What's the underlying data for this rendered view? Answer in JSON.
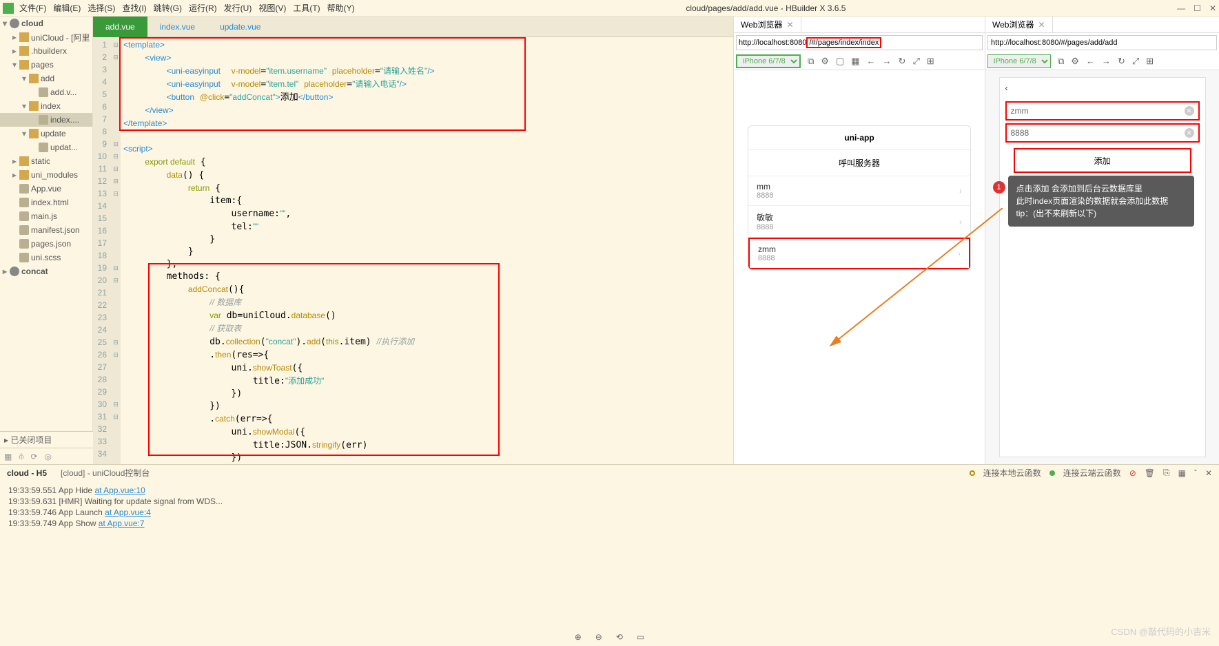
{
  "titlebar": {
    "menus": [
      "文件(F)",
      "编辑(E)",
      "选择(S)",
      "查找(I)",
      "跳转(G)",
      "运行(R)",
      "发行(U)",
      "视图(V)",
      "工具(T)",
      "帮助(Y)"
    ],
    "title": "cloud/pages/add/add.vue - HBuilder X 3.6.5",
    "winbtns": [
      "—",
      "☐",
      "✕"
    ]
  },
  "sidebar": {
    "root": "cloud",
    "items": [
      {
        "indent": 1,
        "chev": "▸",
        "ico": "ico-folder",
        "label": "uniCloud - [阿里"
      },
      {
        "indent": 1,
        "chev": "▸",
        "ico": "ico-folder",
        "label": ".hbuilderx"
      },
      {
        "indent": 1,
        "chev": "▾",
        "ico": "ico-folder-open",
        "label": "pages"
      },
      {
        "indent": 2,
        "chev": "▾",
        "ico": "ico-folder-open",
        "label": "add"
      },
      {
        "indent": 3,
        "chev": "",
        "ico": "ico-file",
        "label": "add.v..."
      },
      {
        "indent": 2,
        "chev": "▾",
        "ico": "ico-folder-open",
        "label": "index"
      },
      {
        "indent": 3,
        "chev": "",
        "ico": "ico-file",
        "label": "index....",
        "active": true
      },
      {
        "indent": 2,
        "chev": "▾",
        "ico": "ico-folder-open",
        "label": "update"
      },
      {
        "indent": 3,
        "chev": "",
        "ico": "ico-file",
        "label": "updat..."
      },
      {
        "indent": 1,
        "chev": "▸",
        "ico": "ico-folder",
        "label": "static"
      },
      {
        "indent": 1,
        "chev": "▸",
        "ico": "ico-folder",
        "label": "uni_modules"
      },
      {
        "indent": 1,
        "chev": "",
        "ico": "ico-file",
        "label": "App.vue"
      },
      {
        "indent": 1,
        "chev": "",
        "ico": "ico-file",
        "label": "index.html"
      },
      {
        "indent": 1,
        "chev": "",
        "ico": "ico-file",
        "label": "main.js"
      },
      {
        "indent": 1,
        "chev": "",
        "ico": "ico-file",
        "label": "manifest.json"
      },
      {
        "indent": 1,
        "chev": "",
        "ico": "ico-file",
        "label": "pages.json"
      },
      {
        "indent": 1,
        "chev": "",
        "ico": "ico-file",
        "label": "uni.scss"
      }
    ],
    "root2": "concat",
    "closed": "已关闭项目"
  },
  "tabs": [
    "add.vue",
    "index.vue",
    "update.vue"
  ],
  "gutter_max": 34,
  "preview1": {
    "tab": "Web浏览器",
    "url_left": "http://localhost:8080",
    "url_red": "/#/pages/index/index",
    "device": "iPhone 6/7/8",
    "app_title": "uni-app",
    "sub_title": "呼叫服务器",
    "items": [
      {
        "name": "mm",
        "phone": "8888"
      },
      {
        "name": "敏敏",
        "phone": "8888"
      },
      {
        "name": "zmm",
        "phone": "8888",
        "red": true
      }
    ]
  },
  "preview2": {
    "tab": "Web浏览器",
    "url": "http://localhost:8080/#/pages/add/add",
    "device": "iPhone 6/7/8",
    "input1": "zmm",
    "input2": "8888",
    "btn": "添加",
    "anno": "点击添加 会添加到后台云数据库里\n此时index页面渲染的数据就会添加此数据\ntip：(出不来刷新以下)",
    "anno_num": "1"
  },
  "bottom": {
    "tabs": [
      "cloud - H5",
      "[cloud] - uniCloud控制台"
    ],
    "status1": "连接本地云函数",
    "status2": "连接云端云函数",
    "console": [
      {
        "t": "19:33:59.551 App Hide  ",
        "l": "at App.vue:10"
      },
      {
        "t": "19:33:59.631 [HMR] Waiting for update signal from WDS...",
        "l": ""
      },
      {
        "t": "19:33:59.746 App Launch  ",
        "l": "at App.vue:4"
      },
      {
        "t": "19:33:59.749 App Show  ",
        "l": "at App.vue:7"
      }
    ]
  },
  "watermark": "CSDN @敲代码的小吉米"
}
